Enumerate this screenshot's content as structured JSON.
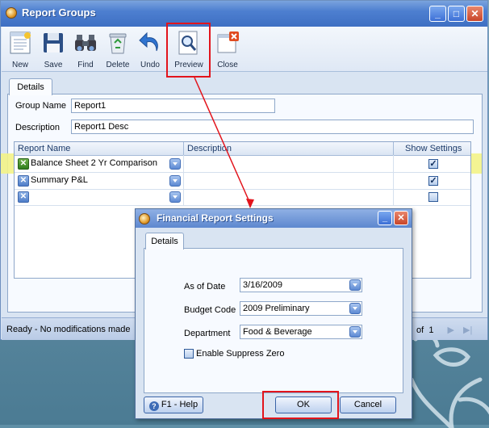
{
  "window": {
    "title": "Report Groups"
  },
  "toolbar": {
    "items": [
      {
        "label": "New",
        "icon": "new-document-icon"
      },
      {
        "label": "Save",
        "icon": "floppy-disk-icon"
      },
      {
        "label": "Find",
        "icon": "binoculars-icon"
      },
      {
        "label": "Delete",
        "icon": "recycle-bin-icon"
      },
      {
        "label": "Undo",
        "icon": "undo-arrow-icon"
      },
      {
        "label": "Preview",
        "icon": "magnifier-preview-icon"
      },
      {
        "label": "Close",
        "icon": "close-window-icon"
      }
    ]
  },
  "details_tab": "Details",
  "form": {
    "group_name_label": "Group Name",
    "group_name_value": "Report1",
    "description_label": "Description",
    "description_value": "Report1 Desc"
  },
  "grid": {
    "headers": [
      "Report Name",
      "Description",
      "Show Settings"
    ],
    "rows": [
      {
        "report_name": "Balance Sheet 2 Yr Comparison",
        "description": "",
        "show_settings": true,
        "highlighted": true
      },
      {
        "report_name": "Summary P&L",
        "description": "",
        "show_settings": true,
        "highlighted": false
      },
      {
        "report_name": "",
        "description": "",
        "show_settings": false,
        "highlighted": false
      }
    ]
  },
  "status": {
    "text": "Ready - No modifications made",
    "pager_of": "of",
    "pager_total": "1"
  },
  "dialog": {
    "title": "Financial Report Settings",
    "tab": "Details",
    "as_of_date_label": "As of Date",
    "as_of_date_value": "3/16/2009",
    "budget_code_label": "Budget Code",
    "budget_code_value": "2009 Preliminary",
    "department_label": "Department",
    "department_value": "Food & Beverage",
    "suppress_zero_label": "Enable Suppress Zero",
    "suppress_zero_checked": false,
    "help_button": "F1 - Help",
    "ok_button": "OK",
    "cancel_button": "Cancel"
  },
  "colors": {
    "annotation": "#e2141c",
    "highlight_row": "#f3f387",
    "title_bar": "#4d7fd0"
  }
}
